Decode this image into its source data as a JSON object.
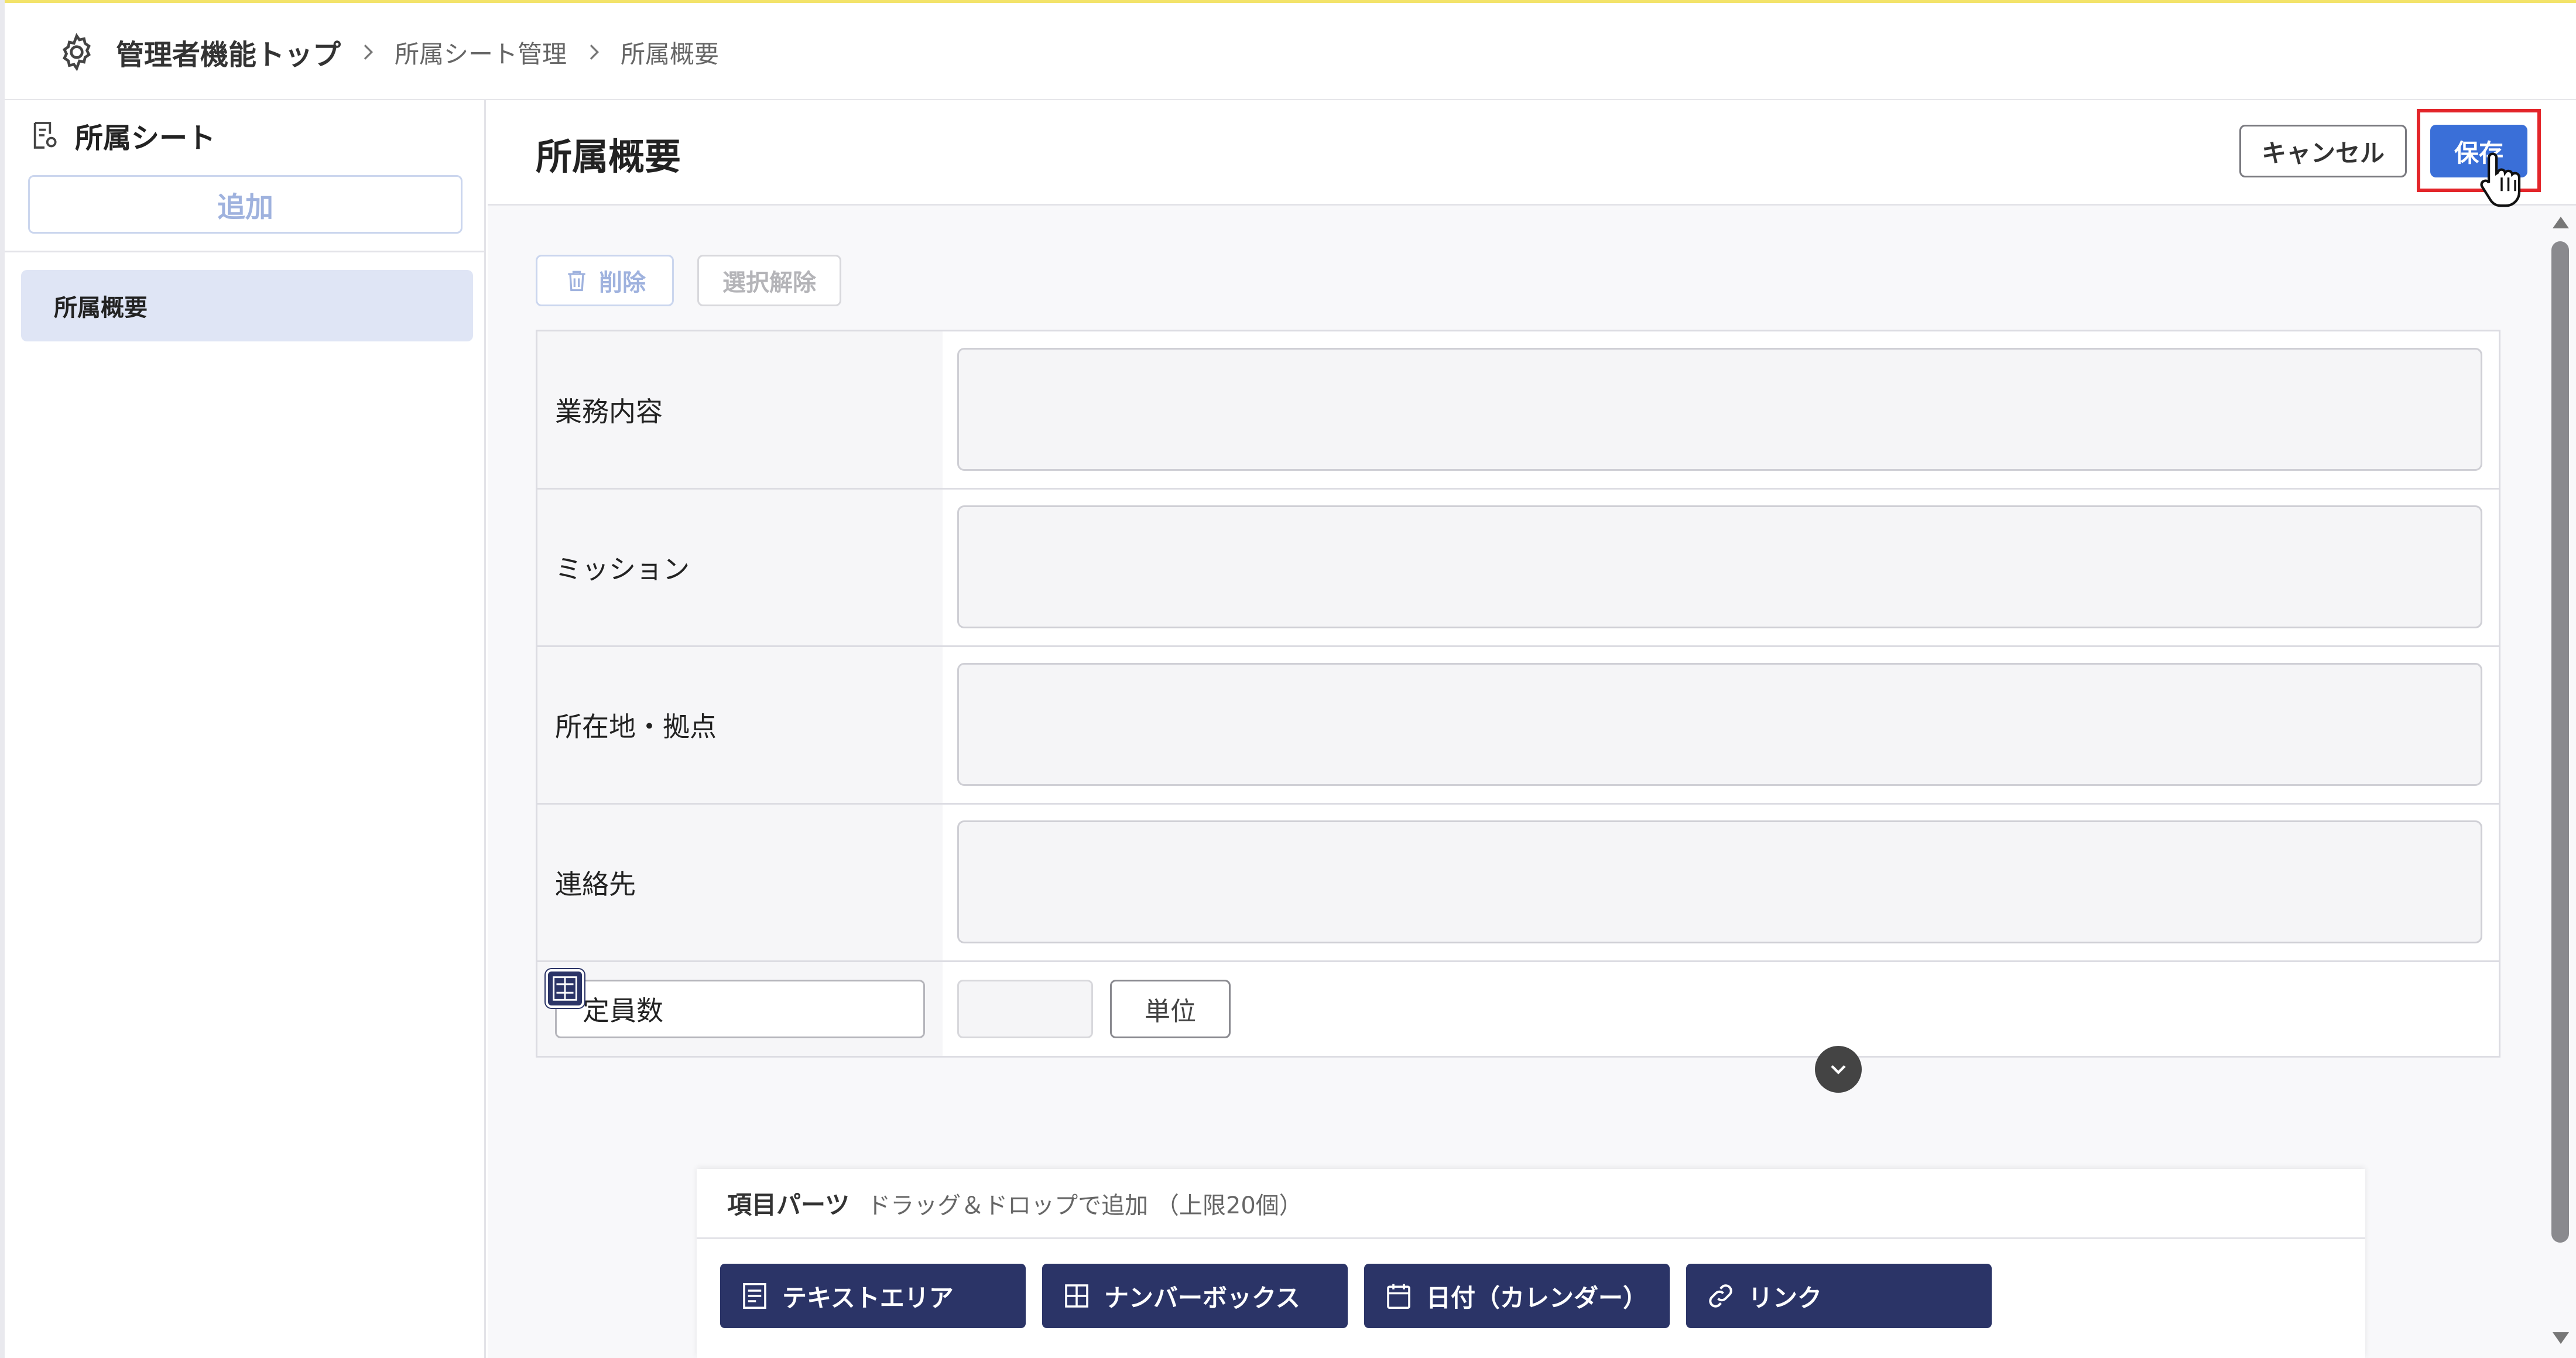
{
  "breadcrumb": {
    "top": "管理者機能トップ",
    "items": [
      "所属シート管理",
      "所属概要"
    ]
  },
  "sidebar": {
    "title": "所属シート",
    "add_label": "追加",
    "items": [
      {
        "label": "所属概要",
        "selected": true
      }
    ]
  },
  "main": {
    "title": "所属概要",
    "cancel_label": "キャンセル",
    "save_label": "保存",
    "toolbar": {
      "delete_label": "削除",
      "clear_label": "選択解除"
    },
    "fields": [
      {
        "label": "業務内容",
        "value": ""
      },
      {
        "label": "ミッション",
        "value": ""
      },
      {
        "label": "所在地・拠点",
        "value": ""
      },
      {
        "label": "連絡先",
        "value": ""
      }
    ],
    "number_field": {
      "name": "定員数",
      "value": "",
      "unit_label": "単位"
    }
  },
  "parts_panel": {
    "title": "項目パーツ",
    "hint": "ドラッグ＆ドロップで追加 （上限20個）",
    "items": [
      {
        "label": "テキストエリア",
        "icon": "text-area-icon"
      },
      {
        "label": "ナンバーボックス",
        "icon": "number-box-icon"
      },
      {
        "label": "日付（カレンダー）",
        "icon": "calendar-icon"
      },
      {
        "label": "リンク",
        "icon": "link-icon"
      }
    ]
  },
  "colors": {
    "primary": "#3a6fd8",
    "parts_button": "#2b3467",
    "highlight": "#e3252a",
    "selected_item": "#dfe5f5"
  }
}
